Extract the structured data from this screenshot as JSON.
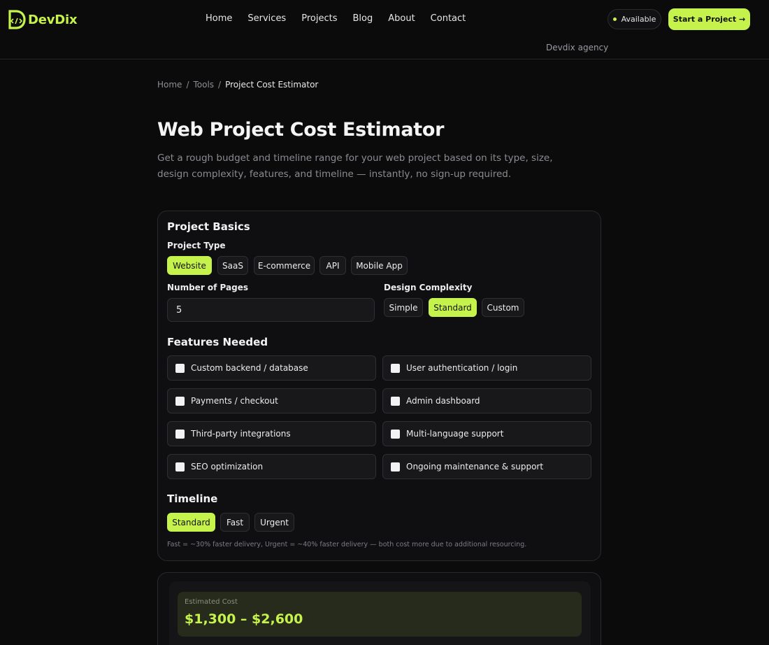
{
  "brand": {
    "name": "DevDix",
    "accent": "#c6f34b",
    "tagline": "Devdix agency"
  },
  "nav": [
    {
      "label": "Home"
    },
    {
      "label": "Services"
    },
    {
      "label": "Projects"
    },
    {
      "label": "Blog"
    },
    {
      "label": "About"
    },
    {
      "label": "Contact"
    }
  ],
  "status": {
    "label": "Available"
  },
  "cta": {
    "label": "Start a Project →"
  },
  "breadcrumb": {
    "home": "Home",
    "sep1": "/",
    "tools": "Tools",
    "sep2": "/",
    "current": "Project Cost Estimator"
  },
  "page": {
    "title": "Web Project Cost Estimator",
    "subtitle": "Get a rough budget and timeline range for your web project based on its type, size, design complexity, features, and timeline — instantly, no sign-up required."
  },
  "basics": {
    "title": "Project Basics",
    "project_type": {
      "label": "Project Type",
      "options": [
        "Website",
        "SaaS",
        "E-commerce",
        "API",
        "Mobile App"
      ],
      "selected": "Website"
    },
    "pages": {
      "label": "Number of Pages",
      "value": "5"
    },
    "design": {
      "label": "Design Complexity",
      "options": [
        "Simple",
        "Standard",
        "Custom"
      ],
      "selected": "Standard"
    }
  },
  "features": {
    "title": "Features Needed",
    "items": [
      {
        "label": "Custom backend / database",
        "checked": false
      },
      {
        "label": "User authentication / login",
        "checked": false
      },
      {
        "label": "Payments / checkout",
        "checked": false
      },
      {
        "label": "Admin dashboard",
        "checked": false
      },
      {
        "label": "Third-party integrations",
        "checked": false
      },
      {
        "label": "Multi-language support",
        "checked": false
      },
      {
        "label": "SEO optimization",
        "checked": false
      },
      {
        "label": "Ongoing maintenance & support",
        "checked": false
      }
    ]
  },
  "timeline": {
    "title": "Timeline",
    "options": [
      "Standard",
      "Fast",
      "Urgent"
    ],
    "selected": "Standard",
    "note": "Fast = ~30% faster delivery, Urgent = ~40% faster delivery — both cost more due to additional resourcing."
  },
  "estimate": {
    "label": "Estimated Cost",
    "value": "$1,300 – $2,600"
  }
}
